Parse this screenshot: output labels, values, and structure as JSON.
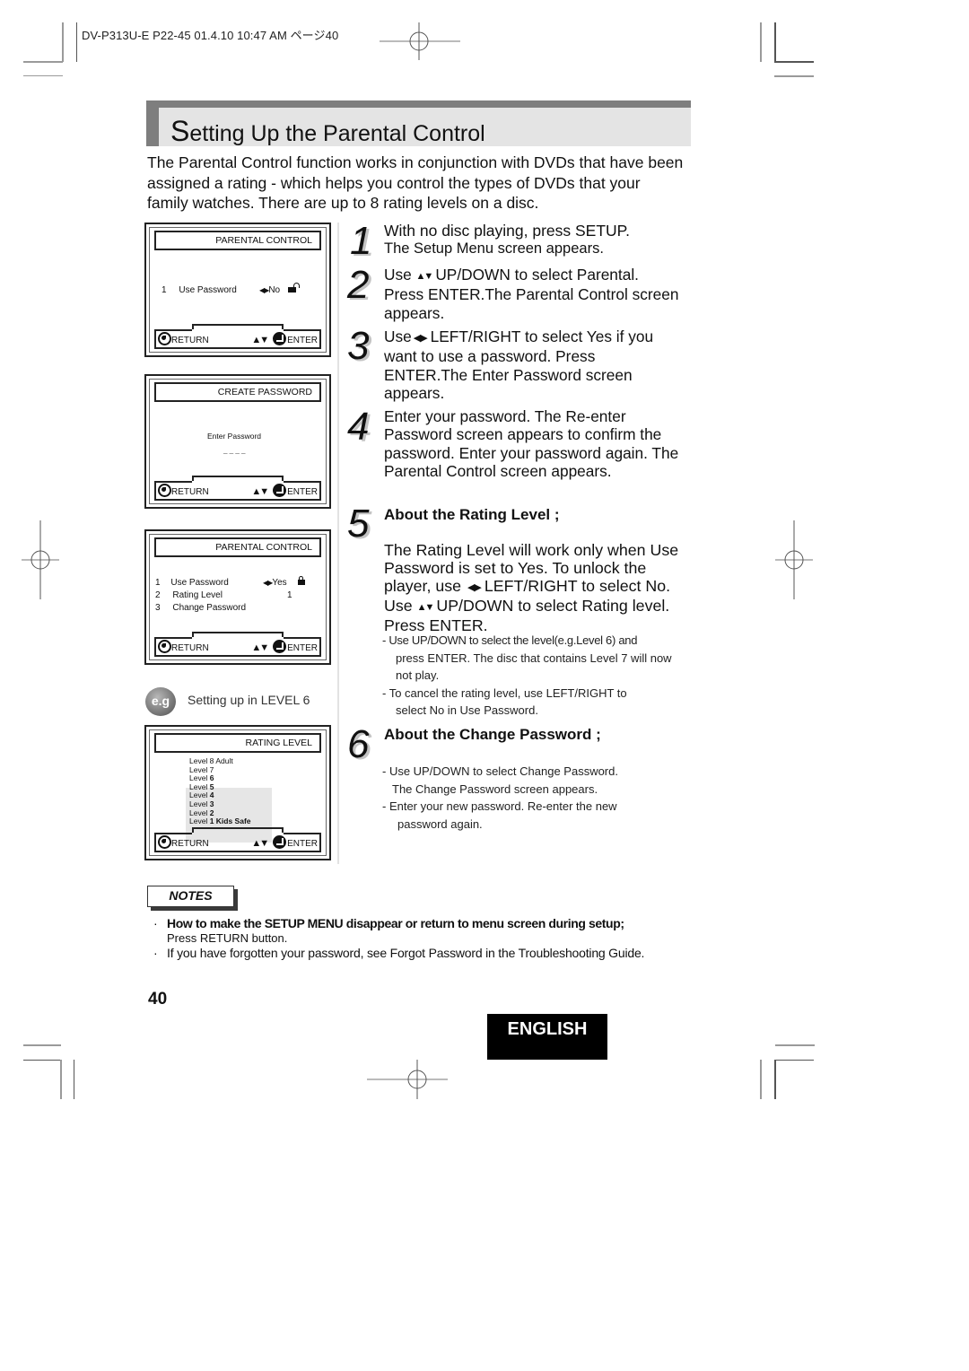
{
  "print_slug": "DV-P313U-E P22-45  01.4.10 10:47 AM  ページ40",
  "title": {
    "first_letter": "S",
    "rest": "etting Up the Parental Control"
  },
  "intro": "The Parental Control function works in conjunction with DVDs that have been assigned a rating - which helps you control the types of DVDs that your family watches. There are up to 8 rating levels on a disc.",
  "screens": {
    "common": {
      "return_label": "RETURN",
      "enter_label": "ENTER",
      "updown_glyph": "▲▼",
      "leftright_glyph": "◀▶"
    },
    "screen1": {
      "header": "PARENTAL CONTROL",
      "rows": [
        {
          "num": "1",
          "label": "Use Password",
          "value": "No",
          "lock_icon": "unlocked-padlock-icon"
        }
      ]
    },
    "screen2": {
      "header": "CREATE PASSWORD",
      "prompt": "Enter Password",
      "mask": "_ _ _ _"
    },
    "screen3": {
      "header": "PARENTAL CONTROL",
      "rows": [
        {
          "num": "1",
          "label": "Use Password",
          "value": "Yes",
          "lock_icon": "locked-padlock-icon"
        },
        {
          "num": "2",
          "label": "Rating Level",
          "value": "1"
        },
        {
          "num": "3",
          "label": "Change Password",
          "value": ""
        }
      ]
    },
    "example": {
      "badge": "e.g",
      "caption": "Setting up in LEVEL 6"
    },
    "screen4": {
      "header": "RATING LEVEL",
      "levels": [
        {
          "prefix": "Level 8",
          "suffix": " Adult",
          "highlighted": false
        },
        {
          "prefix": "Level 7",
          "suffix": "",
          "highlighted": false
        },
        {
          "prefix": "Level",
          "num": " 6",
          "suffix": "",
          "highlighted": true
        },
        {
          "prefix": "Level",
          "num": " 5",
          "suffix": "",
          "highlighted": true
        },
        {
          "prefix": "Level",
          "num": " 4",
          "suffix": "",
          "highlighted": true
        },
        {
          "prefix": "Level",
          "num": " 3",
          "suffix": "",
          "highlighted": true
        },
        {
          "prefix": "Level",
          "num": " 2",
          "suffix": "",
          "highlighted": true
        },
        {
          "prefix": "Level",
          "num": " 1 Kids Safe",
          "suffix": "",
          "highlighted": true
        }
      ]
    }
  },
  "steps": [
    {
      "num": "1",
      "line1": "With no disc playing, press SETUP.",
      "line2": "The Setup Menu screen appears."
    },
    {
      "num": "2",
      "pre": "Use",
      "post": "UP/DOWN to select Parental. Press ENTER.The Parental Control screen appears."
    },
    {
      "num": "3",
      "pre": "Use",
      "post": "LEFT/RIGHT to select Yes if you want to use a password. Press ENTER.The Enter Password screen appears."
    },
    {
      "num": "4",
      "text": "Enter your password. The Re-enter Password screen appears to confirm the password. Enter your password again. The Parental Control screen appears."
    },
    {
      "num": "5",
      "heading": "About the Rating Level ;",
      "body_a": "The Rating Level will work only when Use Password is set to Yes. To unlock the player, use",
      "body_b": "LEFT/RIGHT to select No. Use",
      "body_c": "UP/DOWN to select Rating level. Press ENTER.",
      "bullets": [
        {
          "first": "- Use UP/DOWN to select the level(e.g.Level 6) and",
          "rest": "press ENTER. The disc that contains Level 7 will now not play."
        },
        {
          "first": "- To cancel the rating level, use LEFT/RIGHT to",
          "rest": "select No in Use Password."
        }
      ]
    },
    {
      "num": "6",
      "heading": "About the Change Password ;",
      "bullets": [
        {
          "first": "- Use UP/DOWN to select Change Password.",
          "rest": "The Change Password screen appears."
        },
        {
          "first": "- Enter your new password. Re-enter the new",
          "rest": "password again."
        }
      ]
    }
  ],
  "notes": {
    "label": "NOTES",
    "items": [
      {
        "bold": "How to make the SETUP MENU disappear or return to menu screen during setup;",
        "text": "Press RETURN button."
      },
      {
        "bold": "",
        "text": "If you have forgotten your password, see Forgot Password in the Troubleshooting Guide."
      }
    ]
  },
  "page_number": "40",
  "language_tab": "ENGLISH"
}
